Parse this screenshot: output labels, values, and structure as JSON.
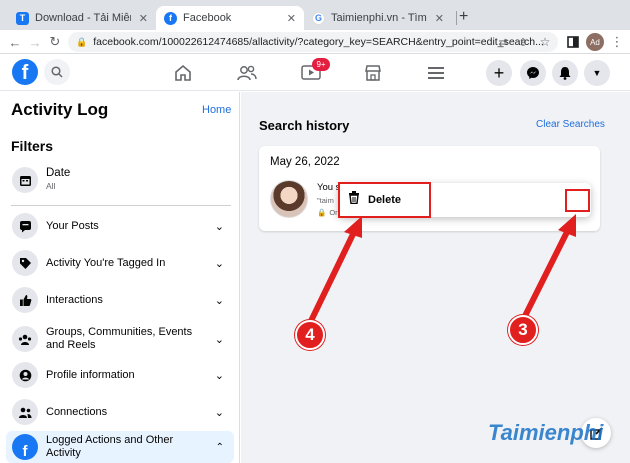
{
  "browser": {
    "tabs": [
      {
        "title": "Download - Tải Miễn Phí VN",
        "icon": "T"
      },
      {
        "title": "Facebook",
        "icon": "f"
      },
      {
        "title": "Taimienphi.vn - Tìm trên Goo",
        "icon": "G"
      }
    ],
    "new_tab": "+",
    "url": "facebook.com/100022612474685/allactivity/?category_key=SEARCH&entry_point=edit_search...",
    "profile_initials": "Ad"
  },
  "fb_header": {
    "logo": "f",
    "watch_badge": "9+"
  },
  "sidebar": {
    "title": "Activity Log",
    "home_link": "Home",
    "filters_label": "Filters",
    "date": {
      "label": "Date",
      "value": "All"
    },
    "items": [
      {
        "label": "Your Posts",
        "icon": "posts-icon"
      },
      {
        "label": "Activity You're Tagged In",
        "icon": "tag-icon"
      },
      {
        "label": "Interactions",
        "icon": "thumbs-up-icon"
      },
      {
        "label": "Groups, Communities, Events and Reels",
        "icon": "groups-icon"
      },
      {
        "label": "Profile information",
        "icon": "profile-icon"
      },
      {
        "label": "Connections",
        "icon": "connections-icon"
      },
      {
        "label": "Logged Actions and Other Activity",
        "icon": "facebook-icon"
      }
    ]
  },
  "main": {
    "heading": "Search history",
    "clear_link": "Clear Searches",
    "date_heading": "May 26, 2022",
    "entry": {
      "line1": "You s",
      "line2": "\"taim",
      "line3": "Or"
    },
    "more_button": "•••"
  },
  "context_menu": {
    "delete_label": "Delete"
  },
  "annotations": {
    "step_3": "3",
    "step_4": "4",
    "color": "#e11f1f"
  },
  "watermark": "Taimienphi"
}
